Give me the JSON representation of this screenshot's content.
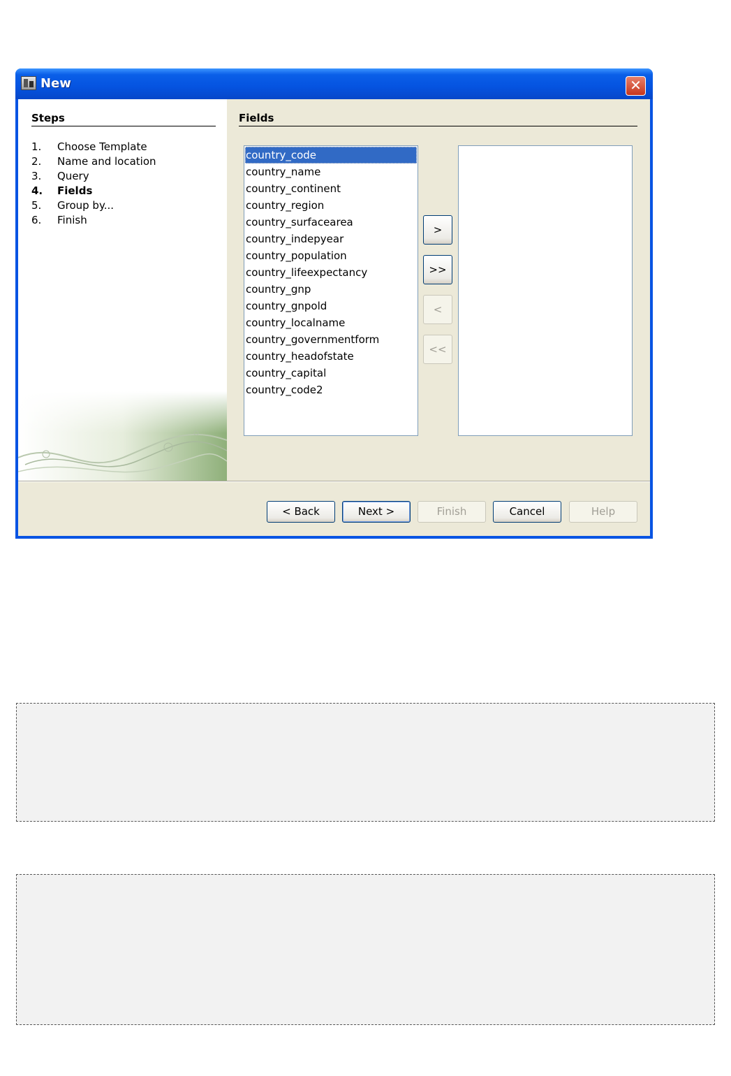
{
  "window": {
    "title": "New",
    "close_symbol": "✕",
    "app_icon": "wizard-app-icon",
    "close_icon": "close-icon"
  },
  "steps": {
    "heading": "Steps",
    "items": [
      {
        "num": "1.",
        "label": "Choose Template",
        "current": false
      },
      {
        "num": "2.",
        "label": "Name and location",
        "current": false
      },
      {
        "num": "3.",
        "label": "Query",
        "current": false
      },
      {
        "num": "4.",
        "label": "Fields",
        "current": true
      },
      {
        "num": "5.",
        "label": "Group by...",
        "current": false
      },
      {
        "num": "6.",
        "label": "Finish",
        "current": false
      }
    ]
  },
  "fields": {
    "heading": "Fields",
    "available": [
      "country_code",
      "country_name",
      "country_continent",
      "country_region",
      "country_surfacearea",
      "country_indepyear",
      "country_population",
      "country_lifeexpectancy",
      "country_gnp",
      "country_gnpold",
      "country_localname",
      "country_governmentform",
      "country_headofstate",
      "country_capital",
      "country_code2"
    ],
    "selected_index": 0,
    "chosen": []
  },
  "move_buttons": {
    "add": ">",
    "add_all": ">>",
    "remove": "<",
    "remove_all": "<<"
  },
  "buttons": {
    "back": "< Back",
    "next": "Next >",
    "finish": "Finish",
    "cancel": "Cancel",
    "help": "Help"
  },
  "colors": {
    "titlebar": "#0553e0",
    "dialog_bg": "#ece9d8",
    "selection": "#316ac5",
    "placeholder_bg": "#f2f2f2"
  }
}
